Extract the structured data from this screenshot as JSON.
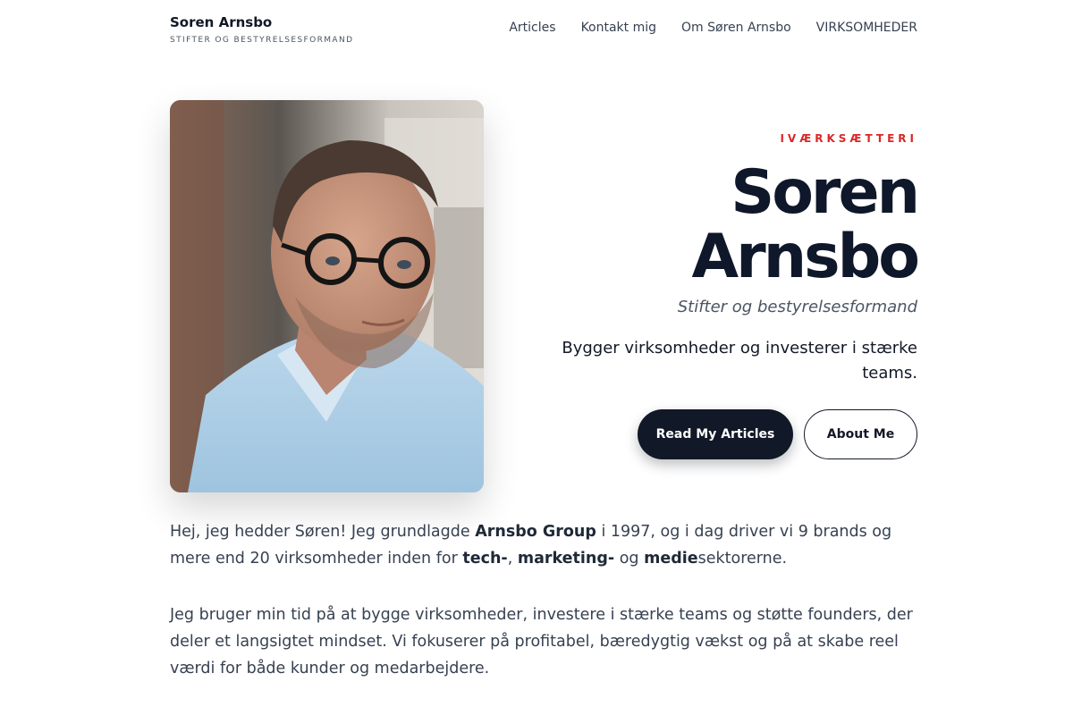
{
  "brand": {
    "name": "Soren Arnsbo",
    "tagline": "STIFTER OG BESTYRELSESFORMAND"
  },
  "nav": {
    "items": [
      {
        "label": "Articles"
      },
      {
        "label": "Kontakt mig"
      },
      {
        "label": "Om Søren Arnsbo"
      },
      {
        "label": "VIRKSOMHEDER"
      }
    ]
  },
  "hero": {
    "eyebrow": "IVÆRKSÆTTERI",
    "title_line1": "Soren",
    "title_line2": "Arnsbo",
    "subtitle": "Stifter og bestyrelsesformand",
    "lead": "Bygger virksomheder og investerer i stærke teams.",
    "primary_button": "Read My Articles",
    "secondary_button": "About Me"
  },
  "intro": {
    "p1_a": "Hej, jeg hedder Søren! Jeg grundlagde ",
    "p1_b": "Arnsbo Group",
    "p1_c": " i 1997, og i dag driver vi 9 brands og mere end 20 virksomheder inden for ",
    "p1_d": "tech-",
    "p1_e": ", ",
    "p1_f": "marketing-",
    "p1_g": " og ",
    "p1_h": "medie",
    "p1_i": "sektorerne.",
    "p2": "Jeg bruger min tid på at bygge virksomheder, investere i stærke teams og støtte founders, der deler et langsigtet mindset. Vi fokuserer på profitabel, bæredygtig vækst og på at skabe reel værdi for både kunder og medarbejdere."
  },
  "colors": {
    "accent": "#dc2626",
    "dark": "#111827"
  }
}
